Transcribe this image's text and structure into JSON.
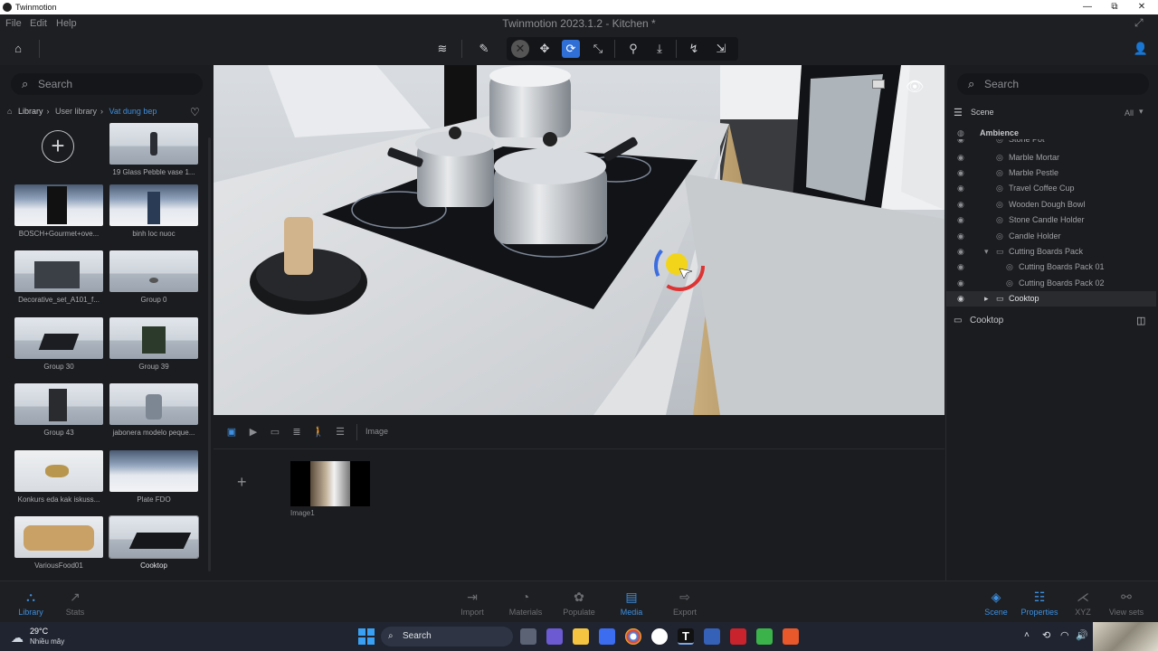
{
  "os": {
    "app_name": "Twinmotion",
    "minimize": "—",
    "maximize": "⧉",
    "close": "✕"
  },
  "menu": {
    "file": "File",
    "edit": "Edit",
    "help": "Help"
  },
  "window_title": "Twinmotion 2023.1.2 - Kitchen *",
  "left": {
    "search_placeholder": "Search",
    "breadcrumb": [
      "Library",
      "User library",
      "Vat dung bep"
    ],
    "items": [
      {
        "label": "19 Glass Pebble vase 1..."
      },
      {
        "label": "BOSCH+Gourmet+ove..."
      },
      {
        "label": "binh loc nuoc"
      },
      {
        "label": "Decorative_set_A101_f..."
      },
      {
        "label": "Group 0"
      },
      {
        "label": "Group 30"
      },
      {
        "label": "Group 39"
      },
      {
        "label": "Group 43"
      },
      {
        "label": "jabonera modelo peque..."
      },
      {
        "label": "Konkurs eda kak iskuss..."
      },
      {
        "label": "Plate FDO"
      },
      {
        "label": "VariousFood01"
      },
      {
        "label": "Cooktop"
      }
    ]
  },
  "media": {
    "tab_label": "Image",
    "image_label": "Image1"
  },
  "right": {
    "search_placeholder": "Search",
    "scene_label": "Scene",
    "filter_label": "All",
    "ambience_label": "Ambience",
    "tree": [
      {
        "label": "Stone Pot"
      },
      {
        "label": "Marble Mortar"
      },
      {
        "label": "Marble Pestle"
      },
      {
        "label": "Travel Coffee Cup"
      },
      {
        "label": "Wooden Dough Bowl"
      },
      {
        "label": "Stone Candle Holder"
      },
      {
        "label": "Candle Holder"
      },
      {
        "label": "Cutting Boards Pack"
      },
      {
        "label": "Cutting Boards Pack 01"
      },
      {
        "label": "Cutting Boards Pack 02"
      },
      {
        "label": "Cooktop"
      }
    ],
    "selected_label": "Cooktop"
  },
  "bottom": {
    "library": "Library",
    "stats": "Stats",
    "import": "Import",
    "materials": "Materials",
    "populate": "Populate",
    "media": "Media",
    "export": "Export",
    "scene": "Scene",
    "properties": "Properties",
    "xyz": "XYZ",
    "view_sets": "View sets"
  },
  "taskbar": {
    "temp": "29°C",
    "weather": "Nhiều mây",
    "search": "Search"
  },
  "colors": {
    "accent": "#3d8fe0",
    "panel": "#1b1c1f"
  }
}
